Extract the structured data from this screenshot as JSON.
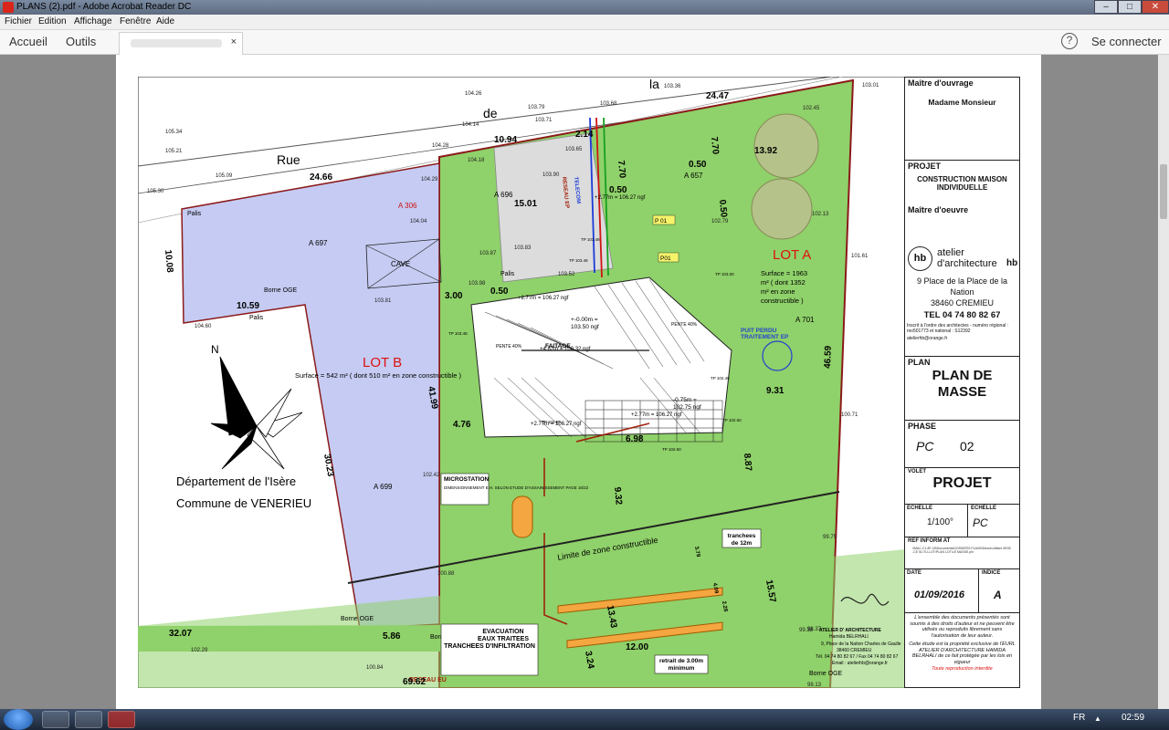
{
  "window": {
    "title": "PLANS                    (2).pdf - Adobe Acrobat Reader DC",
    "min": "–",
    "max": "□",
    "close": "✕"
  },
  "menu": {
    "file": "Fichier",
    "edit": "Edition",
    "view": "Affichage",
    "window": "Fenêtre",
    "help": "Aide"
  },
  "toolbar": {
    "home": "Accueil",
    "tools": "Outils",
    "tab_close": "×",
    "help": "?",
    "connect": "Se connecter"
  },
  "plan": {
    "street": [
      "Rue",
      "de",
      "la"
    ],
    "lot_a": "LOT A",
    "lot_a_surface": [
      "Surface = 1963",
      "m² ( dont 1352",
      "m² en zone",
      "constructible )"
    ],
    "lot_b": "LOT B",
    "lot_b_surface": "Surface = 542 m² ( dont 510 m² en zone constructible )",
    "departement": "Département de l'Isère",
    "commune": "Commune de VENERIEU",
    "north": "N",
    "cave": "CAVE",
    "parcels": [
      "A 306",
      "A 697",
      "A 696",
      "A 699",
      "A 701",
      "A 657"
    ],
    "labels": {
      "palis1": "Palis",
      "palis2": "Palis",
      "palis3": "Palis",
      "borne1": "Borne OGE",
      "borne2": "Borne OGE",
      "borne3": "Borne OGE",
      "borne4": "Borne OGE",
      "limite": "Limite de zone constructible",
      "microstation": "MICROSTATION",
      "micro_sub": "DIMENSIONNEMENT\nE.H. SELON ETUDE\nD'ASSAINISSEMENT\nPAGE 16/22",
      "evac1": "EVACUATION",
      "evac2": "EAUX TRAITEES",
      "evac3": "TRANCHEES D'INFILTRATION",
      "trench": "tranchees",
      "trench2": "de 12m",
      "retrait": "retrait de 3.00m",
      "retrait2": "minimum",
      "puit": "PUIT PERDU",
      "puit2": "TRAITEMENT EP",
      "faitage": "FAITAGE",
      "pente1": "PENTE 40%",
      "pente2": "PENTE 40%",
      "reseau": "RESEAU EU",
      "telecom": "TELECOM",
      "reseau_ep": "RESEAU EP",
      "p01a": "P 01",
      "p01b": "P01",
      "lev1": "+-0.00m =",
      "lev1b": "103.50 ngf",
      "lev2": "-0.75m =",
      "lev2b": "102.75 ngf",
      "lev3": "+2.77m = 106.27 ngf",
      "lev4": "+2.77m = 106.27 ngf",
      "lev5": "+2.77m = 106.27 ngf",
      "lev6": "+4.82m = 108.32 ngf",
      "lev7": "+2.77m = 106.27 ngf",
      "tp1": "TP 103.48",
      "tp2": "TP 103.48",
      "tp3": "TP 103.00",
      "tp4": "TP 102.40",
      "tp5": "TP 102.60",
      "tp6": "TP 102.60",
      "tp7": "TP 102.00",
      "tp8": "TP 103.48"
    },
    "dims": [
      "24.47",
      "24.66",
      "10.94",
      "2.14",
      "7.70",
      "7.70",
      "13.92",
      "0.50",
      "0.50",
      "15.01",
      "10.08",
      "10.59",
      "41.99",
      "30.23",
      "3.00",
      "0.50",
      "4.76",
      "9.31",
      "8.87",
      "6.98",
      "9.32",
      "32.07",
      "5.86",
      "69.62",
      "12.00",
      "3.24",
      "13.43",
      "15.57",
      "3.79",
      "4.09",
      "2.28",
      "46.59",
      "0.50"
    ],
    "heights": [
      "103.36",
      "104.26",
      "103.68",
      "103.79",
      "103.71",
      "103.01",
      "105.34",
      "105.21",
      "104.28",
      "104.18",
      "104.14",
      "103.65",
      "105.09",
      "105.30",
      "104.29",
      "104.04",
      "103.87",
      "103.90",
      "103.83",
      "103.52",
      "103.98",
      "103.81",
      "104.60",
      "102.45",
      "102.79",
      "102.13",
      "101.61",
      "100.71",
      "99.75",
      "102.42",
      "100.88",
      "102.29",
      "100.84",
      "98.37",
      "98.13",
      "99.38"
    ]
  },
  "titleblock": {
    "maitre_ouvrage": "Maître d'ouvrage",
    "client": "Madame Monsieur",
    "projet_head": "PROJET",
    "projet": "CONSTRUCTION MAISON INDIVIDUELLE",
    "maitre_oeuvre": "Maître d'oeuvre",
    "logo": "hb",
    "firm1": "atelier",
    "firm2": "d'architecture",
    "firm_hb": "hb",
    "address1": "9 Place de la Place de la",
    "address2": "Nation",
    "city": "38460 CREMIEU",
    "tel": "TEL 04 74 80 82 67",
    "order": "Inscrit à l'ordre des architectes - numéro régional : mo501773 et national : S12392",
    "email": "atelierhb@orange.fr",
    "plan_head": "PLAN",
    "plan": "PLAN DE MASSE",
    "phase_head": "PHASE",
    "phase_code": "PC",
    "phase_num": "02",
    "volet_head": "VOLET",
    "volet": "PROJET",
    "echelle_head1": "ECHELLE",
    "echelle_head2": "ECHELLE",
    "echelle": "1/100°",
    "echelle2": "PC",
    "ref_head": "REF INFORM AT",
    "ref": "\\\\MAC-C1-8F-40\\Documents\\DOSSIERS PLANS\\Dessin Affaire MSIS-CE SL\\TU-LOT\\PLAN LOT\\LE MASSE.pln",
    "date_head": "DATE",
    "indice_head": "INDICE",
    "date": "01/09/2016",
    "indice": "A",
    "legal1": "L'ensemble des documents présentés sont soumis à des droits d'auteur et ne peuvent être utilisés ou reproduits librement sans l'autorisation de leur auteur.",
    "legal2": "Cette étude est la propriété exclusive de l'EURL ATELIER D'ARCHITECTURE HAMIDA BELRHALI de ce fait protégée par les lois en vigueur",
    "legal3": "Toute reproduction interdite",
    "stamp1": "ATELIER D' ARCHITECTURE",
    "stamp2": "Hamida BELRHALI",
    "stamp3": "9, Place de la Nation Charles de Gaulle",
    "stamp4": "38460 CREMIEU",
    "stamp5": "Tél. 04 74 80 82 67 / Fax 04 74 80 82 67",
    "stamp6": "Email : atelierhb@orange.fr"
  },
  "taskbar": {
    "lang": "FR",
    "time": "02:59",
    "tray_arrow": "▲"
  }
}
